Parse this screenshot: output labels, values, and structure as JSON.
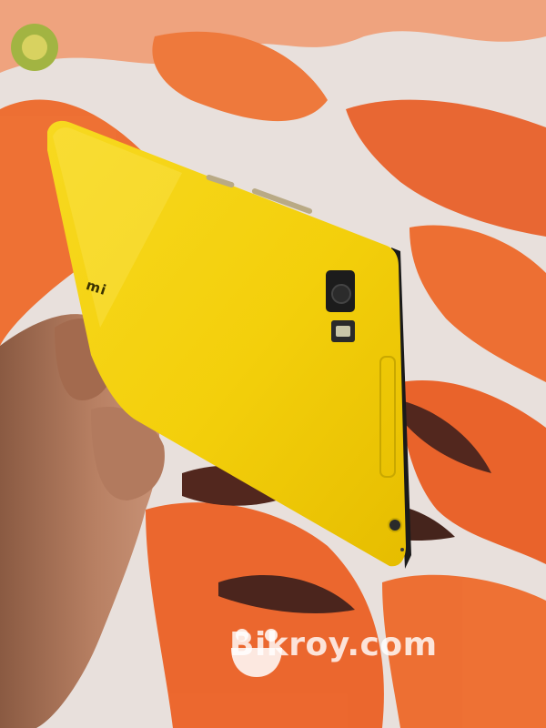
{
  "photo": {
    "subject": "yellow-smartphone-back-in-hand",
    "colors": {
      "phone_body": "#f5d40e",
      "phone_shadow": "#d9b500",
      "camera": "#1c1c1c",
      "fabric_orange": "#ee6a2a",
      "fabric_base": "#e8e0dc",
      "skin": "#b0775a"
    }
  },
  "phone": {
    "brand_mark": "mi"
  },
  "watermark": {
    "text": "Bikroy.com",
    "icon": "smiley-logo-icon"
  }
}
